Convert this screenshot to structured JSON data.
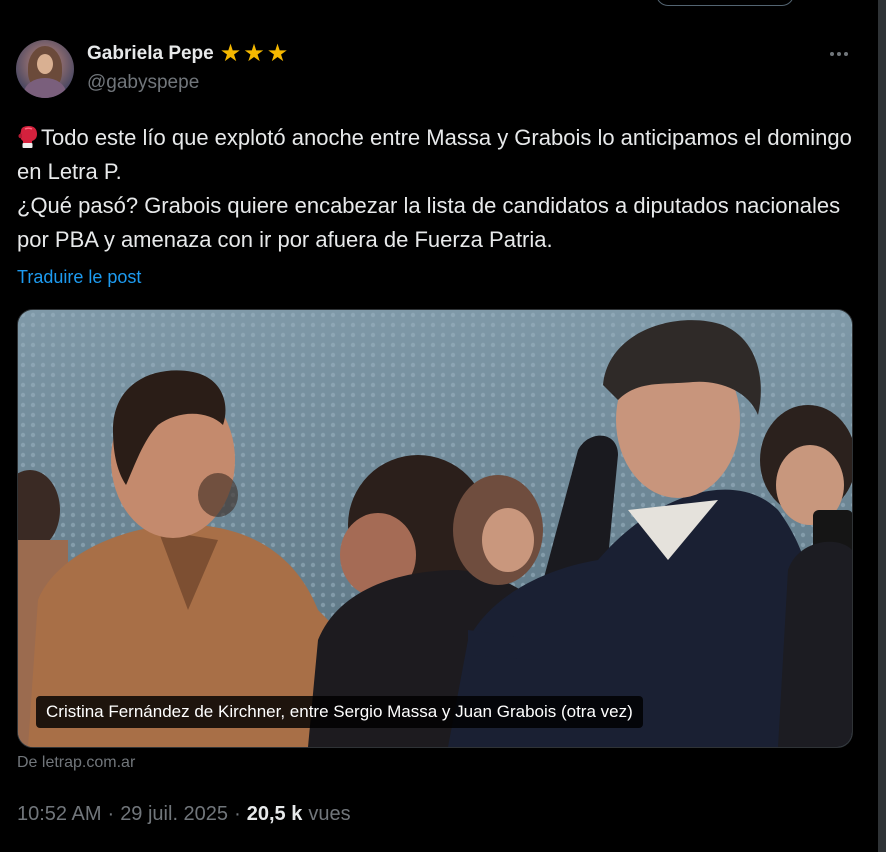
{
  "author": {
    "display_name": "Gabriela Pepe",
    "handle": "@gabyspepe",
    "badge_icons": [
      "star-icon",
      "star-icon",
      "star-icon"
    ],
    "badge_color": "#f5b800"
  },
  "tweet": {
    "emoji_icon": "boxing-glove-icon",
    "lines": [
      "Todo este lío que explotó anoche entre Massa y Grabois lo anticipamos el domingo en Letra P.",
      "¿Qué pasó? Grabois quiere encabezar la lista de candidatos a diputados nacionales por PBA y amenaza con ir por afuera de Fuerza Patria."
    ],
    "translate_label": "Traduire le post"
  },
  "media": {
    "caption": "Cristina Fernández de Kirchner, entre Sergio Massa y Juan Grabois (otra vez)",
    "source": "De letrap.com.ar"
  },
  "meta": {
    "time": "10:52 AM",
    "separator": "·",
    "date": "29 juil. 2025",
    "views_count": "20,5 k",
    "views_label": "vues"
  },
  "colors": {
    "background": "#000000",
    "text": "#e7e9ea",
    "secondary": "#71767b",
    "link": "#1d9bf0"
  }
}
